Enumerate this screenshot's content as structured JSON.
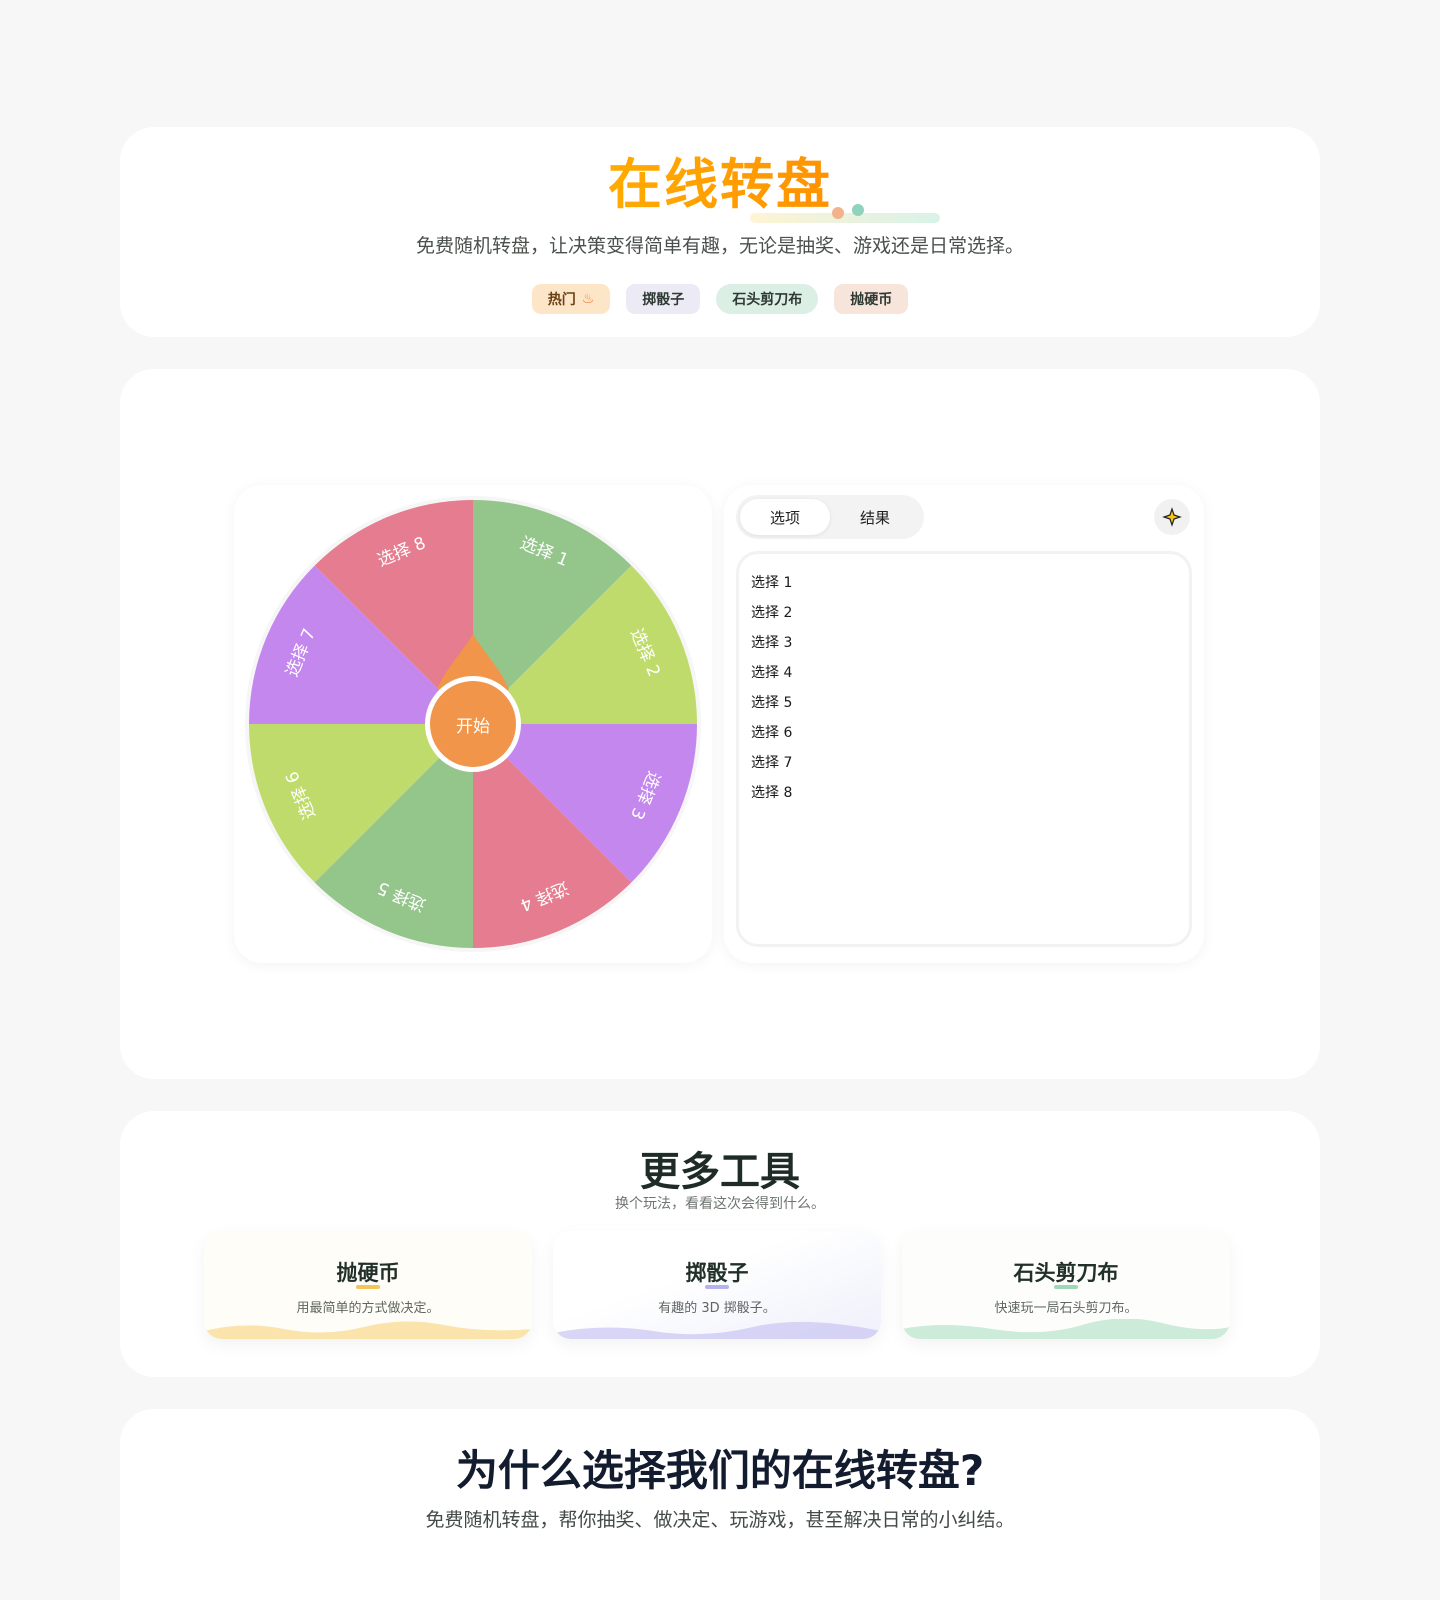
{
  "hero": {
    "title": "在线转盘",
    "subtitle": "免费随机转盘，让决策变得简单有趣，无论是抽奖、游戏还是日常选择。",
    "tags": [
      {
        "label": "热门"
      },
      {
        "label": "掷骰子"
      },
      {
        "label": "石头剪刀布"
      },
      {
        "label": "抛硬币"
      }
    ]
  },
  "wheel": {
    "start_label": "开始",
    "pointer_color": "#f0954a",
    "segments": [
      {
        "label": "选择 1",
        "color": "#94c58b"
      },
      {
        "label": "选择 2",
        "color": "#bfdb6b"
      },
      {
        "label": "选择 3",
        "color": "#c387ee"
      },
      {
        "label": "选择 4",
        "color": "#e57c8f"
      },
      {
        "label": "选择 5",
        "color": "#94c58b"
      },
      {
        "label": "选择 6",
        "color": "#bfdb6b"
      },
      {
        "label": "选择 7",
        "color": "#c387ee"
      },
      {
        "label": "选择 8",
        "color": "#e57c8f"
      }
    ]
  },
  "options_panel": {
    "tabs": [
      {
        "label": "选项",
        "active": true
      },
      {
        "label": "结果",
        "active": false
      }
    ],
    "items": [
      "选择 1",
      "选择 2",
      "选择 3",
      "选择 4",
      "选择 5",
      "选择 6",
      "选择 7",
      "选择 8"
    ]
  },
  "tools": {
    "title": "更多工具",
    "subtitle": "换个玩法，看看这次会得到什么。",
    "cards": [
      {
        "name": "抛硬币",
        "desc": "用最简单的方式做决定。",
        "accent": "#f8d98a"
      },
      {
        "name": "掷骰子",
        "desc": "有趣的 3D 掷骰子。",
        "accent": "#c9c4f2"
      },
      {
        "name": "石头剪刀布",
        "desc": "快速玩一局石头剪刀布。",
        "accent": "#bfe6cf"
      }
    ]
  },
  "why": {
    "title": "为什么选择我们的在线转盘?",
    "text": "免费随机转盘，帮你抽奖、做决定、玩游戏，甚至解决日常的小纠结。"
  }
}
